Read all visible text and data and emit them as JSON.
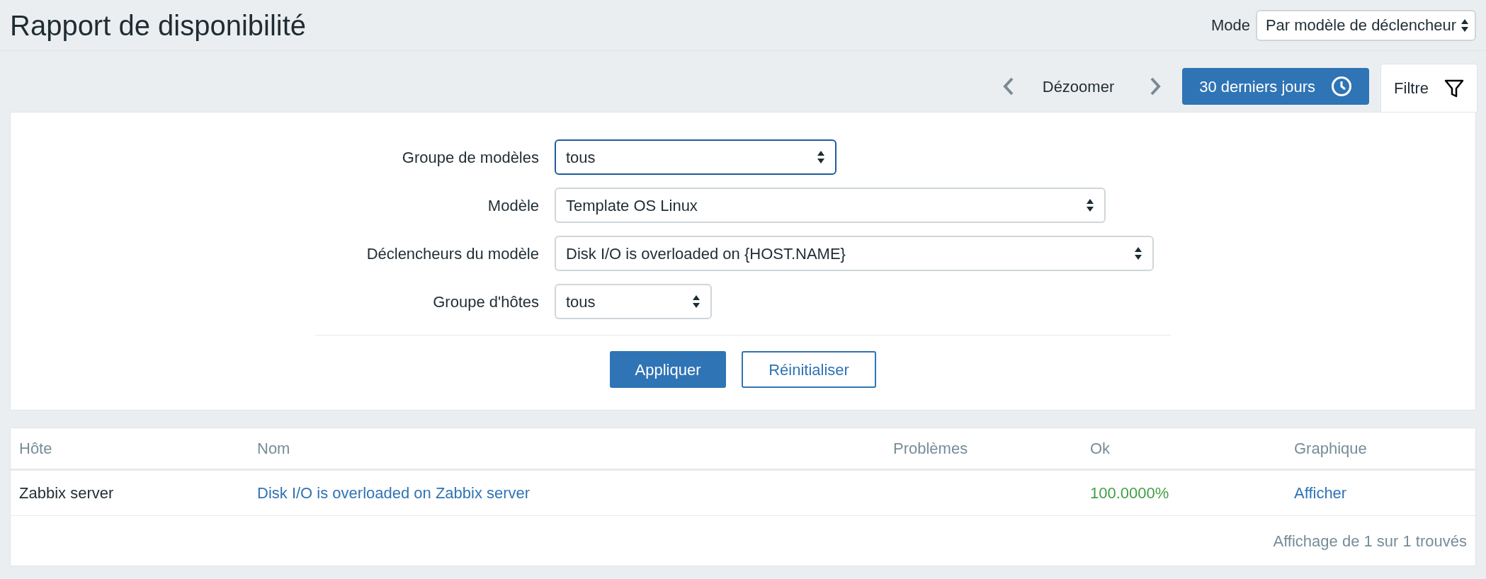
{
  "page_title": "Rapport de disponibilité",
  "mode": {
    "label": "Mode",
    "value": "Par modèle de déclencheur"
  },
  "time_nav": {
    "zoom_out": "Dézoomer",
    "period": "30 derniers jours"
  },
  "tabs": [
    {
      "label": "Filtre",
      "selected": true
    }
  ],
  "filter": {
    "fields": [
      {
        "label": "Groupe de modèles",
        "value": "tous",
        "focused": true
      },
      {
        "label": "Modèle",
        "value": "Template OS Linux",
        "focused": false
      },
      {
        "label": "Déclencheurs du modèle",
        "value": "Disk I/O is overloaded on {HOST.NAME}",
        "focused": false
      },
      {
        "label": "Groupe d'hôtes",
        "value": "tous",
        "focused": false
      }
    ],
    "buttons": [
      {
        "label": "Appliquer",
        "kind": "primary"
      },
      {
        "label": "Réinitialiser",
        "kind": "secondary"
      }
    ]
  },
  "table": {
    "columns": [
      "Hôte",
      "Nom",
      "Problèmes",
      "Ok",
      "Graphique"
    ],
    "rows": [
      {
        "host": "Zabbix server",
        "name": "Disk I/O is overloaded on Zabbix server",
        "ok": "100.0000%",
        "graph": "Afficher"
      }
    ],
    "footer": "Affichage de 1 sur 1 trouvés"
  }
}
